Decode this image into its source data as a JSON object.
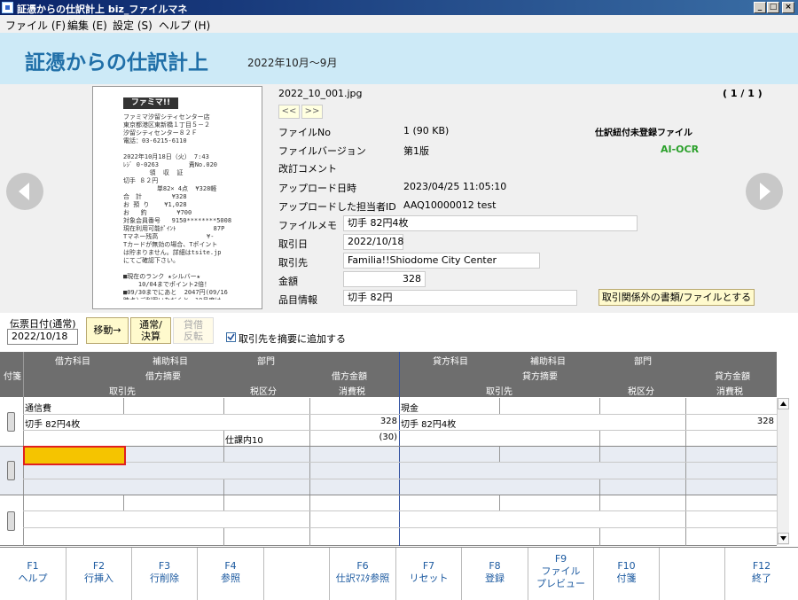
{
  "window": {
    "title": "証憑からの仕訳計上 biz_ファイルマネ",
    "min": "_",
    "max": "□",
    "close": "×"
  },
  "menu": [
    "ファイル (F)",
    "編集 (E)",
    "設定 (S)",
    "ヘルプ (H)"
  ],
  "header": {
    "title": "証憑からの仕訳計上",
    "period": "2022年10月～9月"
  },
  "receipt": {
    "logo": "ファミマ!!",
    "text": "ファミマ汐留シティセンター店\n東京都港区東新橋１丁目５－２\n汐留シティセンター８２Ｆ\n電話：03-6215-6110\n\n2022年10月18日（火） 7:43\nﾚｼﾞ 0-0263        責No.020\n       領  収  証\n切手 ８２円\n         単82× 4点  ¥328軽\n合　計        ¥328\nお 預 り    ¥1,028\nお   釣        ¥700\n対象会員番号   9150********5008\n現在利用可能ﾎﾟｲﾝﾄ          87P\nTマネー残高             ¥-\nTカードが無効の場合、Tポイント\nは貯まりません。詳細はtsite.jp\nにてご確認下さい。\n\n■現在のランク ★シルバー★\n    10/04までポイント2倍！\n■09/30までにあと  2047円(09/16\n時点)ご利用いただくと、10月度は\nシルバー達成。ポイント2倍！\nご利用金額にﾌﾟﾘﾍﾟｲﾄﾞ・ﾁｹｯﾄ類はｼｮｯﾋﾟﾝｸﾞ\nP対象外分は含まれません。"
  },
  "file": {
    "name": "2022_10_001.jpg",
    "page": "( 1 / 1 )",
    "prev": "<<",
    "next": ">>",
    "file_no_label": "ファイルNo",
    "file_no": "1 (90 KB)",
    "status": "仕訳紐付未登録ファイル",
    "version_label": "ファイルバージョン",
    "version": "第1版",
    "ocr": "AI-OCR",
    "comment_label": "改訂コメント",
    "upload_date_label": "アップロード日時",
    "upload_date": "2023/04/25 11:05:10",
    "uploader_label": "アップロードした担当者ID",
    "uploader": "AAQ10000012 test",
    "memo_label": "ファイルメモ",
    "memo": "切手 82円4枚",
    "txdate_label": "取引日",
    "txdate": "2022/10/18",
    "partner_label": "取引先",
    "partner": "Familia!!Shiodome City Center",
    "amount_label": "金額",
    "amount": "328",
    "item_label": "品目情報",
    "item": "切手 82円",
    "exclude_button": "取引関係外の書類/ファイルとする"
  },
  "slip": {
    "date_label": "伝票日付(通常)",
    "date": "2022/10/18",
    "move": "移動→",
    "normal1": "通常/",
    "normal2": "決算",
    "borrow1": "貸借",
    "borrow2": "反転",
    "checkbox_label": "取引先を摘要に追加する",
    "checked": true
  },
  "grid": {
    "side_label": "付箋",
    "debit_headers": [
      "借方科目",
      "補助科目",
      "部門",
      "借方摘要",
      "借方金額",
      "取引先",
      "税区分",
      "消費税"
    ],
    "credit_headers": [
      "貸方科目",
      "補助科目",
      "部門",
      "貸方摘要",
      "貸方金額",
      "取引先",
      "税区分",
      "消費税"
    ],
    "rows": [
      {
        "debit_account": "通信費",
        "debit_memo": "切手 82円4枚",
        "debit_amount": "328",
        "debit_tax": "仕課内10",
        "debit_tax_amount": "(30)",
        "credit_account": "現金",
        "credit_memo": "切手 82円4枚",
        "credit_amount": "328"
      }
    ]
  },
  "fkeys": [
    {
      "k": "F1",
      "l": "ヘルプ"
    },
    {
      "k": "F2",
      "l": "行挿入"
    },
    {
      "k": "F3",
      "l": "行削除"
    },
    {
      "k": "F4",
      "l": "参照"
    },
    {
      "k": "",
      "l": ""
    },
    {
      "k": "F6",
      "l": "仕訳ﾏｽﾀ参照"
    },
    {
      "k": "F7",
      "l": "リセット"
    },
    {
      "k": "F8",
      "l": "登録"
    },
    {
      "k": "F9",
      "l": "ファイル",
      "l2": "プレビュー"
    },
    {
      "k": "F10",
      "l": "付箋"
    },
    {
      "k": "",
      "l": ""
    },
    {
      "k": "F12",
      "l": "終了"
    }
  ],
  "colors": {
    "accent": "#1f6fa8",
    "header_bg": "#cdeaf7",
    "grid_header": "#6e6e6e",
    "selected_cell": "#f5c400",
    "selected_border": "#e02020",
    "ocr": "#2aa02a"
  }
}
